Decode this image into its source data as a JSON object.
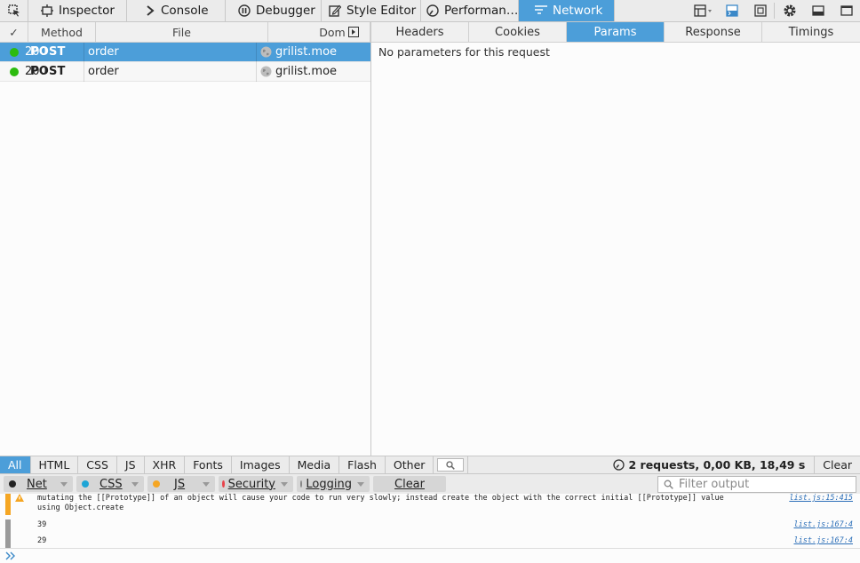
{
  "toolbar": {
    "tabs": [
      {
        "label": "Inspector",
        "icon": "inspector-icon"
      },
      {
        "label": "Console",
        "icon": "console-icon"
      },
      {
        "label": "Debugger",
        "icon": "debugger-icon"
      },
      {
        "label": "Style Editor",
        "icon": "style-editor-icon"
      },
      {
        "label": "Performan…",
        "icon": "performance-icon"
      },
      {
        "label": "Network",
        "icon": "network-icon",
        "active": true
      }
    ]
  },
  "requests": {
    "columns": {
      "check": "✓",
      "method": "Method",
      "file": "File",
      "domain": "Dom"
    },
    "rows": [
      {
        "status": "200",
        "method": "POST",
        "file": "order",
        "domain": "grilist.moe",
        "selected": true
      },
      {
        "status": "200",
        "method": "POST",
        "file": "order",
        "domain": "grilist.moe",
        "selected": false
      }
    ]
  },
  "details": {
    "tabs": [
      "Headers",
      "Cookies",
      "Params",
      "Response",
      "Timings"
    ],
    "active_tab": "Params",
    "message": "No parameters for this request"
  },
  "filters": {
    "types": [
      "All",
      "HTML",
      "CSS",
      "JS",
      "XHR",
      "Fonts",
      "Images",
      "Media",
      "Flash",
      "Other"
    ],
    "active": "All",
    "summary": "2 requests, 0,00 KB, 18,49 s",
    "clear": "Clear"
  },
  "console_filters": {
    "buttons": [
      {
        "label": "Net",
        "color": "#222222"
      },
      {
        "label": "CSS",
        "color": "#1ea5d6"
      },
      {
        "label": "JS",
        "color": "#f5a623"
      },
      {
        "label": "Security",
        "color": "#e8434b"
      },
      {
        "label": "Logging",
        "color": "#888888"
      }
    ],
    "clear": "Clear",
    "filter_placeholder": "Filter output"
  },
  "console": {
    "messages": [
      {
        "text": "mutating the [[Prototype]] of an object will cause your code to run very slowly; instead create the object with the correct initial [[Prototype]] value using Object.create",
        "location": "list.js:15:415"
      },
      {
        "text": "39",
        "location": "list.js:167:4"
      },
      {
        "text": "29",
        "location": "list.js:167:4"
      }
    ]
  },
  "colors": {
    "accent": "#4c9ed9",
    "status_ok": "#2cbb0f",
    "warning": "#f5a623"
  }
}
